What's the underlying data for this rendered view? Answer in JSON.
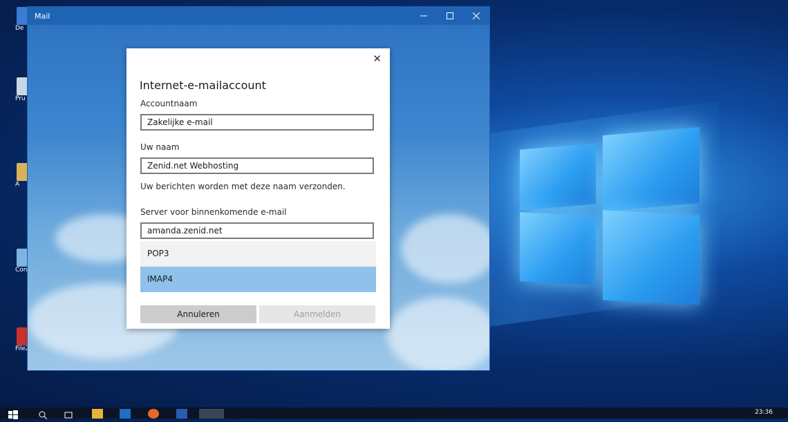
{
  "desktop": {
    "icons": [
      {
        "label": "De",
        "color": "#3a7bd5"
      },
      {
        "label": "Pru",
        "color": "#c9d6e3"
      },
      {
        "label": "A",
        "color": "#d9b25a"
      },
      {
        "label": "Configu",
        "color": "#7fb3e0"
      },
      {
        "label": "FileZi",
        "color": "#c8322a"
      }
    ]
  },
  "window": {
    "title": "Mail",
    "minimize_icon": "minimize-icon",
    "maximize_icon": "maximize-icon",
    "close_icon": "close-icon"
  },
  "dialog": {
    "title": "Internet-e-mailaccount",
    "account_name_label": "Accountnaam",
    "account_name_value": "Zakelijke e-mail",
    "your_name_label": "Uw naam",
    "your_name_value": "Zenid.net Webhosting",
    "your_name_hint": "Uw berichten worden met deze naam verzonden.",
    "incoming_server_label": "Server voor binnenkomende e-mail",
    "incoming_server_value": "amanda.zenid.net",
    "account_type_options": [
      "POP3",
      "IMAP4"
    ],
    "selected_option": "IMAP4",
    "cancel_label": "Annuleren",
    "signin_label": "Aanmelden",
    "colors": {
      "selected_bg": "#8fc1ea",
      "hover_bg": "#f2f2f2",
      "button_bg": "#cccccc",
      "button_disabled_bg": "#e6e6e6",
      "button_disabled_fg": "#a0a0a0"
    }
  },
  "taskbar": {
    "clock": "23:36"
  }
}
